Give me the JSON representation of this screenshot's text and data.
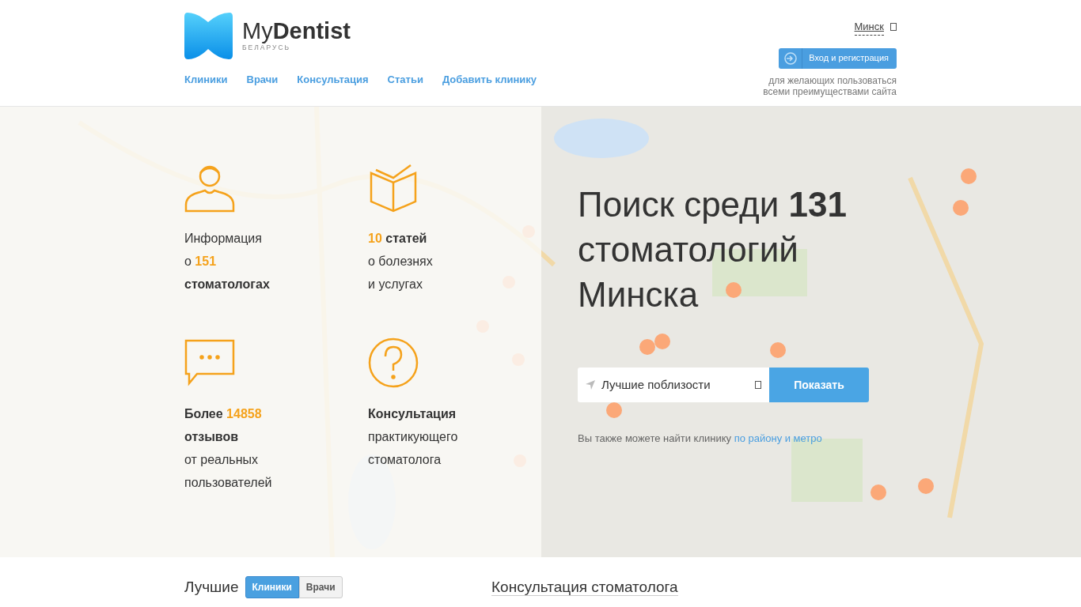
{
  "logo": {
    "name_light": "My",
    "name_bold": "Dentist",
    "country": "БЕЛАРУСЬ"
  },
  "nav": [
    "Клиники",
    "Врачи",
    "Консультация",
    "Статьи",
    "Добавить клинику"
  ],
  "city": "Минск",
  "login_button": "Вход и регистрация",
  "login_note": "для желающих пользоваться всеми преимуществами сайта",
  "features": [
    {
      "kind": "person",
      "lines": [
        [
          {
            "text": "Информация",
            "accent": false,
            "bold": false
          }
        ],
        [
          {
            "text": "о ",
            "accent": false,
            "bold": false
          },
          {
            "text": "151",
            "accent": true,
            "bold": true
          }
        ],
        [
          {
            "text": "стоматологах",
            "accent": false,
            "bold": true
          }
        ]
      ]
    },
    {
      "kind": "book",
      "lines": [
        [
          {
            "text": "10",
            "accent": true,
            "bold": true
          },
          {
            "text": " статей",
            "accent": false,
            "bold": true
          }
        ],
        [
          {
            "text": "о болезнях",
            "accent": false,
            "bold": false
          }
        ],
        [
          {
            "text": "и услугах",
            "accent": false,
            "bold": false
          }
        ]
      ]
    },
    {
      "kind": "chat",
      "lines": [
        [
          {
            "text": "Более ",
            "accent": false,
            "bold": true
          },
          {
            "text": "14858",
            "accent": true,
            "bold": true
          }
        ],
        [
          {
            "text": "отзывов",
            "accent": false,
            "bold": true
          }
        ],
        [
          {
            "text": "от реальных",
            "accent": false,
            "bold": false
          }
        ],
        [
          {
            "text": "пользователей",
            "accent": false,
            "bold": false
          }
        ]
      ]
    },
    {
      "kind": "question",
      "lines": [
        [
          {
            "text": "Консультация",
            "accent": false,
            "bold": true
          }
        ],
        [
          {
            "text": "практикующего",
            "accent": false,
            "bold": false
          }
        ],
        [
          {
            "text": "стоматолога",
            "accent": false,
            "bold": false
          }
        ]
      ]
    }
  ],
  "search": {
    "title_before": "Поиск среди ",
    "title_count": "131",
    "title_after": "стоматологий Минска",
    "value": "Лучшие поблизости",
    "button": "Показать",
    "hint": "Вы также можете найти клинику ",
    "hint_link": "по району и метро"
  },
  "best": {
    "title": "Лучшие",
    "tabs": [
      {
        "label": "Клиники",
        "selected": true
      },
      {
        "label": "Врачи",
        "selected": false
      }
    ]
  },
  "consult_title": "Консультация стоматолога"
}
